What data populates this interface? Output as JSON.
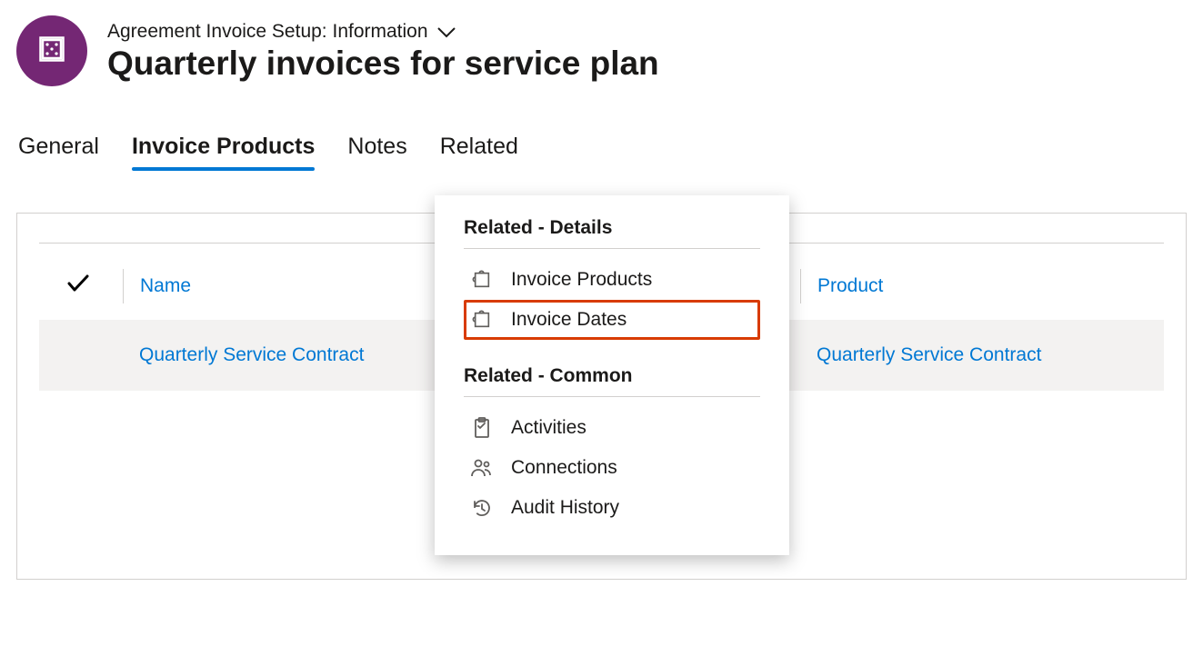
{
  "header": {
    "breadcrumb": "Agreement Invoice Setup: Information",
    "title": "Quarterly invoices for service plan"
  },
  "tabs": {
    "general": "General",
    "invoice_products": "Invoice Products",
    "notes": "Notes",
    "related": "Related"
  },
  "columns": {
    "name": "Name",
    "product": "Product"
  },
  "rows": [
    {
      "name": "Quarterly Service Contract",
      "product": "Quarterly Service Contract"
    }
  ],
  "dropdown": {
    "section_details_title": "Related - Details",
    "section_common_title": "Related - Common",
    "items": {
      "invoice_products": "Invoice Products",
      "invoice_dates": "Invoice Dates",
      "activities": "Activities",
      "connections": "Connections",
      "audit_history": "Audit History"
    }
  }
}
